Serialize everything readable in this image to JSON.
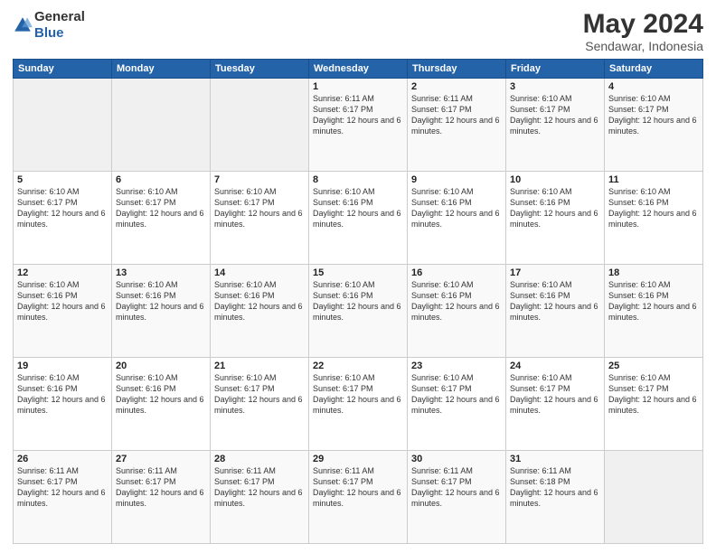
{
  "logo": {
    "general": "General",
    "blue": "Blue"
  },
  "title": {
    "month": "May 2024",
    "location": "Sendawar, Indonesia"
  },
  "weekdays": [
    "Sunday",
    "Monday",
    "Tuesday",
    "Wednesday",
    "Thursday",
    "Friday",
    "Saturday"
  ],
  "weeks": [
    [
      {
        "day": "",
        "sunrise": "",
        "sunset": "",
        "daylight": ""
      },
      {
        "day": "",
        "sunrise": "",
        "sunset": "",
        "daylight": ""
      },
      {
        "day": "",
        "sunrise": "",
        "sunset": "",
        "daylight": ""
      },
      {
        "day": "1",
        "sunrise": "Sunrise: 6:11 AM",
        "sunset": "Sunset: 6:17 PM",
        "daylight": "Daylight: 12 hours and 6 minutes."
      },
      {
        "day": "2",
        "sunrise": "Sunrise: 6:11 AM",
        "sunset": "Sunset: 6:17 PM",
        "daylight": "Daylight: 12 hours and 6 minutes."
      },
      {
        "day": "3",
        "sunrise": "Sunrise: 6:10 AM",
        "sunset": "Sunset: 6:17 PM",
        "daylight": "Daylight: 12 hours and 6 minutes."
      },
      {
        "day": "4",
        "sunrise": "Sunrise: 6:10 AM",
        "sunset": "Sunset: 6:17 PM",
        "daylight": "Daylight: 12 hours and 6 minutes."
      }
    ],
    [
      {
        "day": "5",
        "sunrise": "Sunrise: 6:10 AM",
        "sunset": "Sunset: 6:17 PM",
        "daylight": "Daylight: 12 hours and 6 minutes."
      },
      {
        "day": "6",
        "sunrise": "Sunrise: 6:10 AM",
        "sunset": "Sunset: 6:17 PM",
        "daylight": "Daylight: 12 hours and 6 minutes."
      },
      {
        "day": "7",
        "sunrise": "Sunrise: 6:10 AM",
        "sunset": "Sunset: 6:17 PM",
        "daylight": "Daylight: 12 hours and 6 minutes."
      },
      {
        "day": "8",
        "sunrise": "Sunrise: 6:10 AM",
        "sunset": "Sunset: 6:16 PM",
        "daylight": "Daylight: 12 hours and 6 minutes."
      },
      {
        "day": "9",
        "sunrise": "Sunrise: 6:10 AM",
        "sunset": "Sunset: 6:16 PM",
        "daylight": "Daylight: 12 hours and 6 minutes."
      },
      {
        "day": "10",
        "sunrise": "Sunrise: 6:10 AM",
        "sunset": "Sunset: 6:16 PM",
        "daylight": "Daylight: 12 hours and 6 minutes."
      },
      {
        "day": "11",
        "sunrise": "Sunrise: 6:10 AM",
        "sunset": "Sunset: 6:16 PM",
        "daylight": "Daylight: 12 hours and 6 minutes."
      }
    ],
    [
      {
        "day": "12",
        "sunrise": "Sunrise: 6:10 AM",
        "sunset": "Sunset: 6:16 PM",
        "daylight": "Daylight: 12 hours and 6 minutes."
      },
      {
        "day": "13",
        "sunrise": "Sunrise: 6:10 AM",
        "sunset": "Sunset: 6:16 PM",
        "daylight": "Daylight: 12 hours and 6 minutes."
      },
      {
        "day": "14",
        "sunrise": "Sunrise: 6:10 AM",
        "sunset": "Sunset: 6:16 PM",
        "daylight": "Daylight: 12 hours and 6 minutes."
      },
      {
        "day": "15",
        "sunrise": "Sunrise: 6:10 AM",
        "sunset": "Sunset: 6:16 PM",
        "daylight": "Daylight: 12 hours and 6 minutes."
      },
      {
        "day": "16",
        "sunrise": "Sunrise: 6:10 AM",
        "sunset": "Sunset: 6:16 PM",
        "daylight": "Daylight: 12 hours and 6 minutes."
      },
      {
        "day": "17",
        "sunrise": "Sunrise: 6:10 AM",
        "sunset": "Sunset: 6:16 PM",
        "daylight": "Daylight: 12 hours and 6 minutes."
      },
      {
        "day": "18",
        "sunrise": "Sunrise: 6:10 AM",
        "sunset": "Sunset: 6:16 PM",
        "daylight": "Daylight: 12 hours and 6 minutes."
      }
    ],
    [
      {
        "day": "19",
        "sunrise": "Sunrise: 6:10 AM",
        "sunset": "Sunset: 6:16 PM",
        "daylight": "Daylight: 12 hours and 6 minutes."
      },
      {
        "day": "20",
        "sunrise": "Sunrise: 6:10 AM",
        "sunset": "Sunset: 6:16 PM",
        "daylight": "Daylight: 12 hours and 6 minutes."
      },
      {
        "day": "21",
        "sunrise": "Sunrise: 6:10 AM",
        "sunset": "Sunset: 6:17 PM",
        "daylight": "Daylight: 12 hours and 6 minutes."
      },
      {
        "day": "22",
        "sunrise": "Sunrise: 6:10 AM",
        "sunset": "Sunset: 6:17 PM",
        "daylight": "Daylight: 12 hours and 6 minutes."
      },
      {
        "day": "23",
        "sunrise": "Sunrise: 6:10 AM",
        "sunset": "Sunset: 6:17 PM",
        "daylight": "Daylight: 12 hours and 6 minutes."
      },
      {
        "day": "24",
        "sunrise": "Sunrise: 6:10 AM",
        "sunset": "Sunset: 6:17 PM",
        "daylight": "Daylight: 12 hours and 6 minutes."
      },
      {
        "day": "25",
        "sunrise": "Sunrise: 6:10 AM",
        "sunset": "Sunset: 6:17 PM",
        "daylight": "Daylight: 12 hours and 6 minutes."
      }
    ],
    [
      {
        "day": "26",
        "sunrise": "Sunrise: 6:11 AM",
        "sunset": "Sunset: 6:17 PM",
        "daylight": "Daylight: 12 hours and 6 minutes."
      },
      {
        "day": "27",
        "sunrise": "Sunrise: 6:11 AM",
        "sunset": "Sunset: 6:17 PM",
        "daylight": "Daylight: 12 hours and 6 minutes."
      },
      {
        "day": "28",
        "sunrise": "Sunrise: 6:11 AM",
        "sunset": "Sunset: 6:17 PM",
        "daylight": "Daylight: 12 hours and 6 minutes."
      },
      {
        "day": "29",
        "sunrise": "Sunrise: 6:11 AM",
        "sunset": "Sunset: 6:17 PM",
        "daylight": "Daylight: 12 hours and 6 minutes."
      },
      {
        "day": "30",
        "sunrise": "Sunrise: 6:11 AM",
        "sunset": "Sunset: 6:17 PM",
        "daylight": "Daylight: 12 hours and 6 minutes."
      },
      {
        "day": "31",
        "sunrise": "Sunrise: 6:11 AM",
        "sunset": "Sunset: 6:18 PM",
        "daylight": "Daylight: 12 hours and 6 minutes."
      },
      {
        "day": "",
        "sunrise": "",
        "sunset": "",
        "daylight": ""
      }
    ]
  ]
}
